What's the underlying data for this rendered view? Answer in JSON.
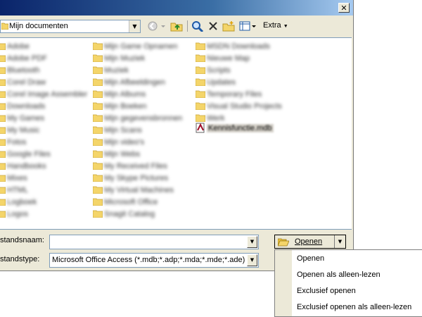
{
  "window": {
    "close_glyph": "✕"
  },
  "toolbar": {
    "location": "Mijn documenten",
    "extra_label": "Extra",
    "icons": [
      "back-icon",
      "up-folder-icon",
      "search-web-icon",
      "delete-icon",
      "new-folder-icon",
      "views-icon"
    ]
  },
  "file_list": {
    "columns": [
      [
        "Adobe",
        "Adobe PDF",
        "Bluetooth",
        "Corel Draw",
        "Corel Image Assembler",
        "Downloads",
        "My Games",
        "My Music",
        "Fotos",
        "Google Files",
        "Handbooks",
        "Mixes",
        "HTML",
        "Logboek",
        "Logos"
      ],
      [
        "Mijn Game Opnamen",
        "Mijn Muziek",
        "Muziek",
        "Mijn Afbeeldingen",
        "Mijn Albums",
        "Mijn Boeken",
        "Mijn gegevensbronnen",
        "Mijn Scans",
        "Mijn video's",
        "Mijn Webs",
        "My Received Files",
        "My Skype Pictures",
        "My Virtual Machines",
        "Microsoft Office",
        "Snagit Catalog"
      ],
      [
        "MSDN Downloads",
        "Nieuwe Map",
        "Scripts",
        "Updates",
        "Temporary Files",
        "Visual Studio Projects",
        "Werk"
      ]
    ],
    "selected_file": "Kennisfunctie.mdb"
  },
  "fields": {
    "filename_label": "standsnaam:",
    "filename_value": "",
    "filetype_label": "standstype:",
    "filetype_value": "Microsoft Office Access (*.mdb;*.adp;*.mda;*.mde;*.ade)"
  },
  "open_button": {
    "label": "Openen"
  },
  "open_menu": {
    "items": [
      "Openen",
      "Openen als alleen-lezen",
      "Exclusief openen",
      "Exclusief openen als alleen-lezen"
    ]
  },
  "colors": {
    "folder": "#f4d56a",
    "selection": "#d4d0c8",
    "menu_stripe": "#ece9d8"
  }
}
